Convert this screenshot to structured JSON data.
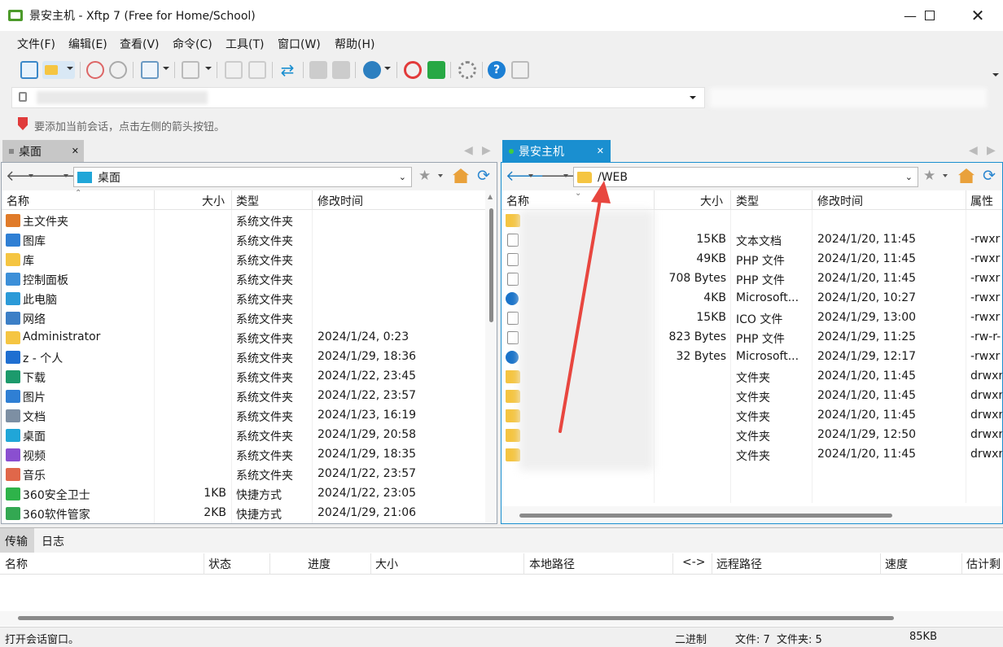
{
  "window": {
    "title": "景安主机 - Xftp 7 (Free for Home/School)"
  },
  "menu": [
    "文件(F)",
    "编辑(E)",
    "查看(V)",
    "命令(C)",
    "工具(T)",
    "窗口(W)",
    "帮助(H)"
  ],
  "hint": "要添加当前会话，点击左侧的箭头按钮。",
  "left": {
    "tab_label": "桌面",
    "path": "桌面",
    "columns": [
      "名称",
      "大小",
      "类型",
      "修改时间"
    ],
    "rows": [
      {
        "name": "主文件夹",
        "size": "",
        "type": "系统文件夹",
        "modified": "",
        "icon": "home-icon",
        "color": "#e07b2a"
      },
      {
        "name": "图库",
        "size": "",
        "type": "系统文件夹",
        "modified": "",
        "icon": "gallery-icon",
        "color": "#2f7fd4"
      },
      {
        "name": "库",
        "size": "",
        "type": "系统文件夹",
        "modified": "",
        "icon": "folder-icon",
        "color": "#f5c542"
      },
      {
        "name": "控制面板",
        "size": "",
        "type": "系统文件夹",
        "modified": "",
        "icon": "control-panel-icon",
        "color": "#3c8fd8"
      },
      {
        "name": "此电脑",
        "size": "",
        "type": "系统文件夹",
        "modified": "",
        "icon": "computer-icon",
        "color": "#2b9ad8"
      },
      {
        "name": "网络",
        "size": "",
        "type": "系统文件夹",
        "modified": "",
        "icon": "network-icon",
        "color": "#3c7fc6"
      },
      {
        "name": "Administrator",
        "size": "",
        "type": "系统文件夹",
        "modified": "2024/1/24, 0:23",
        "icon": "folder-icon",
        "color": "#f5c542"
      },
      {
        "name": "z - 个人",
        "size": "",
        "type": "系统文件夹",
        "modified": "2024/1/29, 18:36",
        "icon": "onedrive-icon",
        "color": "#1f6fd1"
      },
      {
        "name": "下载",
        "size": "",
        "type": "系统文件夹",
        "modified": "2024/1/22, 23:45",
        "icon": "download-icon",
        "color": "#1c9a6c"
      },
      {
        "name": "图片",
        "size": "",
        "type": "系统文件夹",
        "modified": "2024/1/22, 23:57",
        "icon": "pictures-icon",
        "color": "#2f7fd4"
      },
      {
        "name": "文档",
        "size": "",
        "type": "系统文件夹",
        "modified": "2024/1/23, 16:19",
        "icon": "documents-icon",
        "color": "#7d8fa3"
      },
      {
        "name": "桌面",
        "size": "",
        "type": "系统文件夹",
        "modified": "2024/1/29, 20:58",
        "icon": "desktop-icon",
        "color": "#20a6d8"
      },
      {
        "name": "视频",
        "size": "",
        "type": "系统文件夹",
        "modified": "2024/1/29, 18:35",
        "icon": "videos-icon",
        "color": "#8a4fd0"
      },
      {
        "name": "音乐",
        "size": "",
        "type": "系统文件夹",
        "modified": "2024/1/22, 23:57",
        "icon": "music-icon",
        "color": "#e0674a"
      },
      {
        "name": "360安全卫士",
        "size": "1KB",
        "type": "快捷方式",
        "modified": "2024/1/22, 23:05",
        "icon": "360-security-icon",
        "color": "#2eb34a"
      },
      {
        "name": "360软件管家",
        "size": "2KB",
        "type": "快捷方式",
        "modified": "2024/1/29, 21:06",
        "icon": "360-software-icon",
        "color": "#33a852"
      }
    ]
  },
  "right": {
    "tab_label": "景安主机",
    "path": "/WEB",
    "columns": [
      "名称",
      "大小",
      "类型",
      "修改时间",
      "属性"
    ],
    "rows": [
      {
        "name": "",
        "size": "",
        "type": "",
        "modified": "",
        "attr": "",
        "icon": "folder-icon"
      },
      {
        "name": "",
        "size": "15KB",
        "type": "文本文档",
        "modified": "2024/1/20, 11:45",
        "attr": "-rwxr",
        "icon": "text-file-icon"
      },
      {
        "name": "",
        "size": "49KB",
        "type": "PHP 文件",
        "modified": "2024/1/20, 11:45",
        "attr": "-rwxr",
        "icon": "file-icon"
      },
      {
        "name": "",
        "size": "708 Bytes",
        "type": "PHP 文件",
        "modified": "2024/1/20, 11:45",
        "attr": "-rwxr",
        "icon": "file-icon"
      },
      {
        "name": "",
        "size": "4KB",
        "type": "Microsoft...",
        "modified": "2024/1/20, 10:27",
        "attr": "-rwxr",
        "icon": "edge-icon"
      },
      {
        "name": "",
        "size": "15KB",
        "type": "ICO 文件",
        "modified": "2024/1/29, 13:00",
        "attr": "-rwxr",
        "icon": "file-icon"
      },
      {
        "name": "",
        "size": "823 Bytes",
        "type": "PHP 文件",
        "modified": "2024/1/29, 11:25",
        "attr": "-rw-r-",
        "icon": "file-icon"
      },
      {
        "name": "",
        "size": "32 Bytes",
        "type": "Microsoft...",
        "modified": "2024/1/29, 12:17",
        "attr": "-rwxr",
        "icon": "edge-icon"
      },
      {
        "name": "",
        "size": "",
        "type": "文件夹",
        "modified": "2024/1/20, 11:45",
        "attr": "drwxr",
        "icon": "folder-icon"
      },
      {
        "name": "",
        "size": "",
        "type": "文件夹",
        "modified": "2024/1/20, 11:45",
        "attr": "drwxr",
        "icon": "folder-icon"
      },
      {
        "name": "",
        "size": "",
        "type": "文件夹",
        "modified": "2024/1/20, 11:45",
        "attr": "drwxr",
        "icon": "folder-icon"
      },
      {
        "name": "",
        "size": "",
        "type": "文件夹",
        "modified": "2024/1/29, 12:50",
        "attr": "drwxr",
        "icon": "folder-icon"
      },
      {
        "name": "",
        "size": "",
        "type": "文件夹",
        "modified": "2024/1/20, 11:45",
        "attr": "drwxr",
        "icon": "folder-icon"
      }
    ]
  },
  "transfer": {
    "tabs": [
      "传输",
      "日志"
    ],
    "columns": [
      "名称",
      "状态",
      "进度",
      "大小",
      "本地路径",
      "<->",
      "远程路径",
      "速度",
      "估计剩"
    ]
  },
  "status": {
    "message": "打开会话窗口。",
    "mode": "二进制",
    "counts": "文件: 7  文件夹: 5",
    "size": "85KB"
  },
  "colors": {
    "accent": "#1e88c8",
    "active_tab": "#1a8fd0",
    "arrow": "#e8463f"
  }
}
